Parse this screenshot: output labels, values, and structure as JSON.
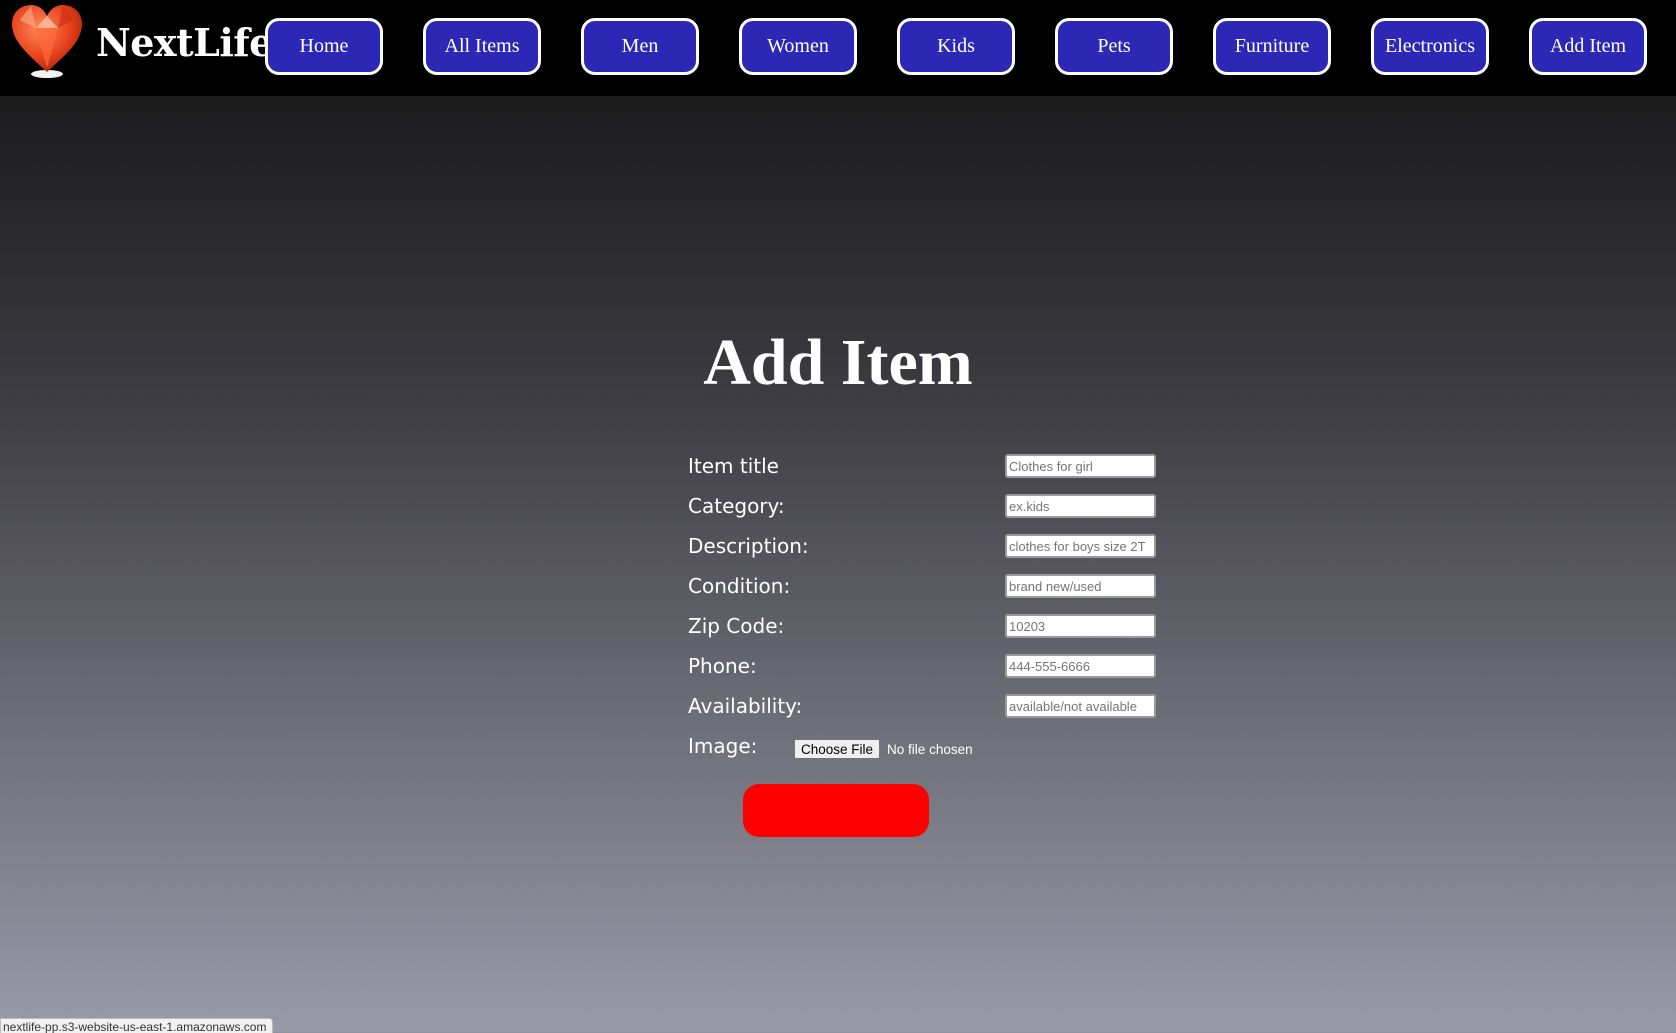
{
  "brand": {
    "name": "NextLife",
    "logo_icon": "heart-gem-icon"
  },
  "nav": {
    "items": [
      {
        "label": "Home"
      },
      {
        "label": "All Items"
      },
      {
        "label": "Men"
      },
      {
        "label": "Women"
      },
      {
        "label": "Kids"
      },
      {
        "label": "Pets"
      },
      {
        "label": "Furniture"
      },
      {
        "label": "Electronics"
      },
      {
        "label": "Add Item"
      }
    ]
  },
  "page": {
    "title": "Add Item"
  },
  "form": {
    "fields": [
      {
        "label": "Item title",
        "placeholder": "Clothes for girl"
      },
      {
        "label": "Category:",
        "placeholder": "ex.kids"
      },
      {
        "label": "Description:",
        "placeholder": "clothes for boys size 2T"
      },
      {
        "label": "Condition:",
        "placeholder": "brand new/used"
      },
      {
        "label": "Zip Code:",
        "placeholder": "10203"
      },
      {
        "label": "Phone:",
        "placeholder": "444-555-6666"
      },
      {
        "label": "Availability:",
        "placeholder": "available/not available"
      }
    ],
    "image": {
      "label": "Image:",
      "button_label": "Choose File",
      "status": "No file chosen"
    },
    "submit_label": ""
  },
  "statusbar": {
    "text": "nextlife-pp.s3-website-us-east-1.amazonaws.com"
  },
  "colors": {
    "nav_button_bg": "#2d27b5",
    "submit_bg": "#fe0000",
    "topbar_bg": "#000000"
  }
}
